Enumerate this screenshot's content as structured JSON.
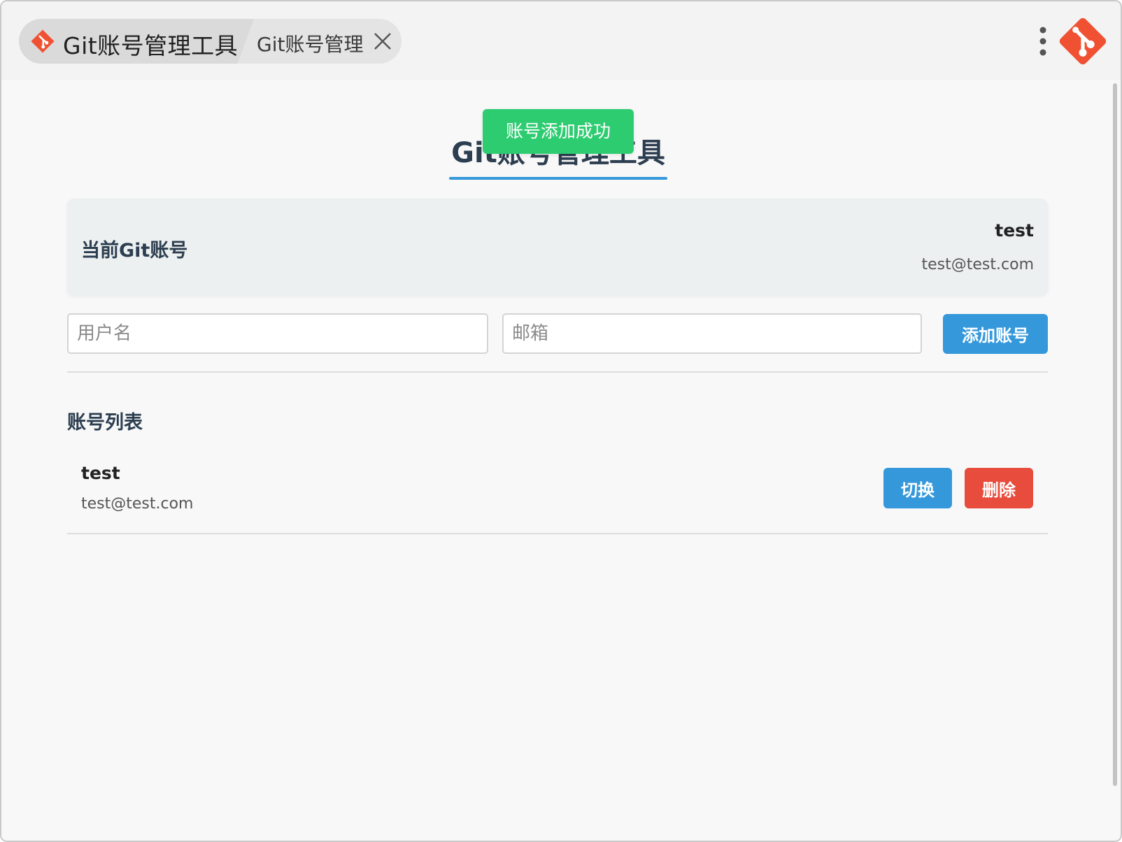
{
  "titlebar": {
    "active_tab_title": "Git账号管理工具",
    "second_tab_title": "Git账号管理"
  },
  "colors": {
    "accent": "#3498db",
    "danger": "#e74c3c",
    "success": "#2ecc71",
    "git_brand": "#f05133",
    "heading": "#2c3e50"
  },
  "icons": {
    "tab_logo": "git-logo-icon",
    "close": "close-icon",
    "menu": "more-vertical-icon",
    "app_logo": "git-logo-icon"
  },
  "toast": {
    "message": "账号添加成功"
  },
  "page": {
    "title": "Git账号管理工具"
  },
  "current_account": {
    "label": "当前Git账号",
    "name": "test",
    "email": "test@test.com"
  },
  "form": {
    "username_placeholder": "用户名",
    "username_value": "",
    "email_placeholder": "邮箱",
    "email_value": "",
    "add_button": "添加账号"
  },
  "account_list": {
    "heading": "账号列表",
    "items": [
      {
        "name": "test",
        "email": "test@test.com",
        "switch_label": "切换",
        "delete_label": "删除"
      }
    ]
  }
}
